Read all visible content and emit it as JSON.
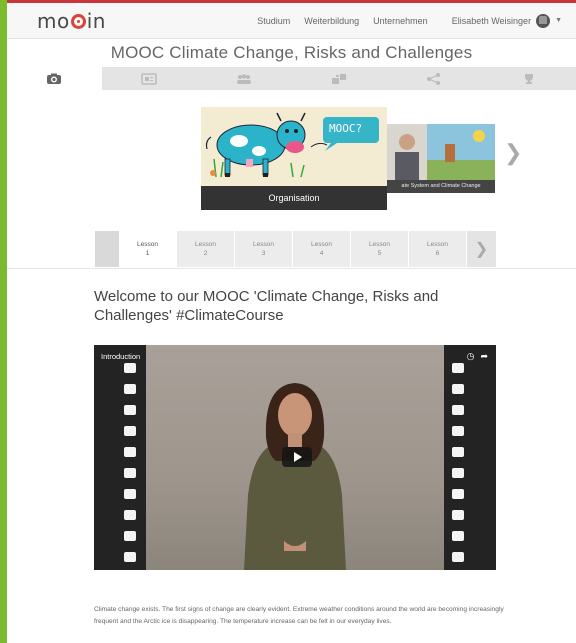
{
  "brand": {
    "logo_text_pre": "mo",
    "logo_text_post": "in"
  },
  "nav": {
    "studium": "Studium",
    "weiterbildung": "Weiterbildung",
    "unternehmen": "Unternehmen",
    "user_name": "Elisabeth Weisinger"
  },
  "course": {
    "title": "MOOC Climate Change, Risks and Challenges"
  },
  "tabs": [
    {
      "icon": "eye-icon"
    },
    {
      "icon": "board-icon"
    },
    {
      "icon": "people-icon"
    },
    {
      "icon": "cards-icon"
    },
    {
      "icon": "share-icon"
    },
    {
      "icon": "trophy-icon"
    }
  ],
  "carousel": {
    "main_caption": "Organisation",
    "main_badge": "MOOC?",
    "next_caption": "ate System and Climate Change"
  },
  "lessons": [
    {
      "label": "Lesson",
      "num": "1"
    },
    {
      "label": "Lesson",
      "num": "2"
    },
    {
      "label": "Lesson",
      "num": "3"
    },
    {
      "label": "Lesson",
      "num": "4"
    },
    {
      "label": "Lesson",
      "num": "5"
    },
    {
      "label": "Lesson",
      "num": "6"
    }
  ],
  "welcome": {
    "heading": "Welcome to our MOOC 'Climate Change, Risks and Challenges' #ClimateCourse"
  },
  "video": {
    "title": "Introduction"
  },
  "intro_text": "Climate change exists. The first signs of change are clearly evident. Extreme weather conditions around the world are becoming increasingly frequent and the Arctic ice is disappearing. The temperature increase can be felt in our everyday lives.",
  "colors": {
    "page_bg": "#7dbb2e",
    "accent_red": "#c9353a",
    "logo_ring": "#d8453c"
  }
}
